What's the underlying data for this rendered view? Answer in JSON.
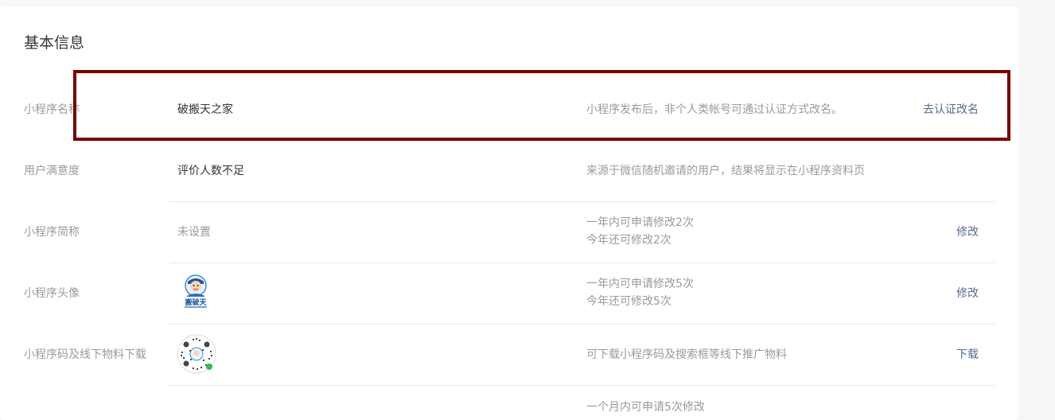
{
  "section": {
    "title": "基本信息"
  },
  "rows": [
    {
      "label": "小程序名称",
      "value": "破搬天之家",
      "desc": [
        "小程序发布后，非个人类帐号可通过认证方式改名。"
      ],
      "action": "去认证改名"
    },
    {
      "label": "用户满意度",
      "value": "评价人数不足",
      "desc": [
        "来源于微信随机邀请的用户，结果将显示在小程序资料页"
      ],
      "action": ""
    },
    {
      "label": "小程序简称",
      "value": "未设置",
      "desc": [
        "一年内可申请修改2次",
        "今年还可修改2次"
      ],
      "action": "修改"
    },
    {
      "label": "小程序头像",
      "value": "",
      "desc": [
        "一年内可申请修改5次",
        "今年还可修改5次"
      ],
      "action": "修改"
    },
    {
      "label": "小程序码及线下物料下载",
      "value": "",
      "desc": [
        "可下载小程序码及搜索框等线下推广物料"
      ],
      "action": "下载"
    },
    {
      "label": "",
      "value": "",
      "desc": [
        "一个月内可申请5次修改"
      ],
      "action": ""
    }
  ],
  "avatar_text": "搬破天",
  "colors": {
    "link": "#576b95",
    "highlight_border": "#7a0000",
    "label": "#9a9a9a",
    "text": "#353535"
  }
}
